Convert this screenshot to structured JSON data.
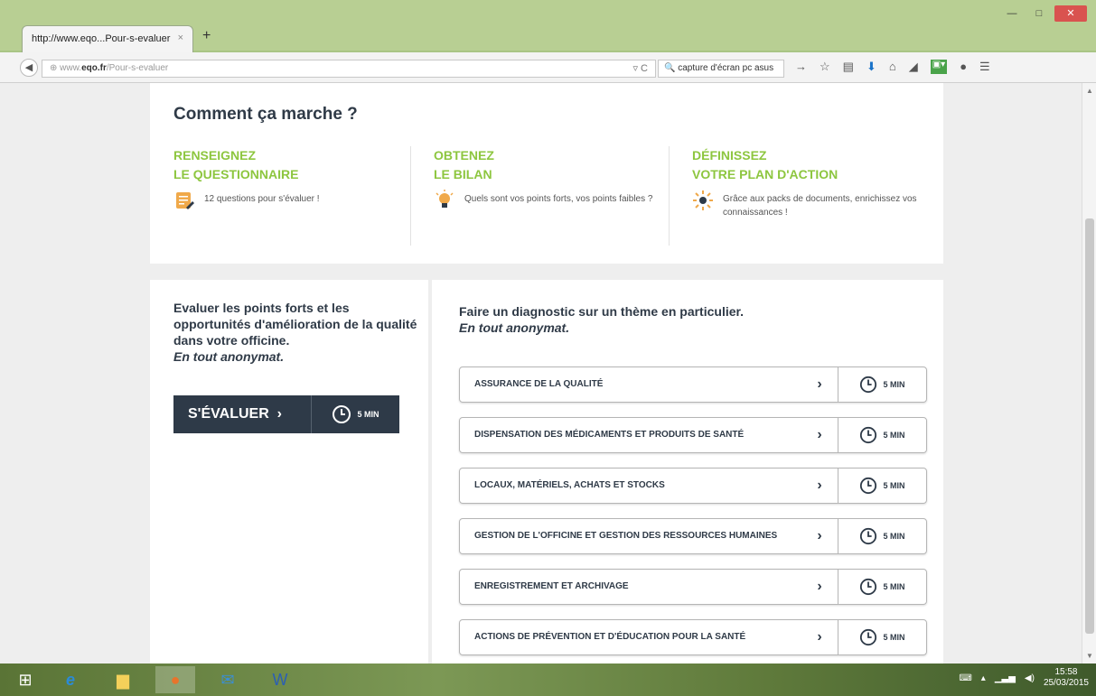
{
  "browser": {
    "tab_title": "http://www.eqo...Pour-s-evaluer",
    "tab_close": "×",
    "new_tab": "+",
    "url_domain": "www.eqo.fr",
    "url_prefix": "www.",
    "url_host": "eqo.fr",
    "url_path": "/Pour-s-evaluer",
    "search_value": "capture d'écran pc asus"
  },
  "page": {
    "how_title": "Comment ça marche ?",
    "steps": [
      {
        "title1": "RENSEIGNEZ",
        "title2": "LE QUESTIONNAIRE",
        "desc": "12 questions pour s'évaluer !",
        "icon": "questionnaire-icon"
      },
      {
        "title1": "OBTENEZ",
        "title2": "LE BILAN",
        "desc": "Quels sont vos points forts, vos points faibles ?",
        "icon": "lightbulb-icon"
      },
      {
        "title1": "DÉFINISSEZ",
        "title2": "VOTRE PLAN D'ACTION",
        "desc": "Grâce aux packs de documents, enrichissez vos connaissances !",
        "icon": "sun-icon"
      }
    ],
    "left_text": "Evaluer les points forts et les opportunités d'amélioration de la qualité dans votre officine.",
    "left_anon": "En tout anonymat.",
    "eval_button": "S'ÉVALUER",
    "eval_time": "5 MIN",
    "right_title": "Faire un diagnostic sur un thème en particulier.",
    "right_anon": "En tout anonymat.",
    "themes": [
      {
        "label": "ASSURANCE DE LA QUALITÉ",
        "time": "5 MIN"
      },
      {
        "label": "DISPENSATION DES MÉDICAMENTS ET PRODUITS DE SANTÉ",
        "time": "5 MIN"
      },
      {
        "label": "LOCAUX, MATÉRIELS, ACHATS ET STOCKS",
        "time": "5 MIN"
      },
      {
        "label": "GESTION DE L'OFFICINE ET GESTION DES RESSOURCES HUMAINES",
        "time": "5 MIN"
      },
      {
        "label": "ENREGISTREMENT ET ARCHIVAGE",
        "time": "5 MIN"
      },
      {
        "label": "ACTIONS DE PRÉVENTION ET D'ÉDUCATION POUR LA SANTÉ",
        "time": "5 MIN"
      }
    ]
  },
  "taskbar": {
    "time": "15:58",
    "date": "25/03/2015"
  },
  "colors": {
    "accent_green": "#8dc63f",
    "dark_navy": "#2e3a48"
  }
}
